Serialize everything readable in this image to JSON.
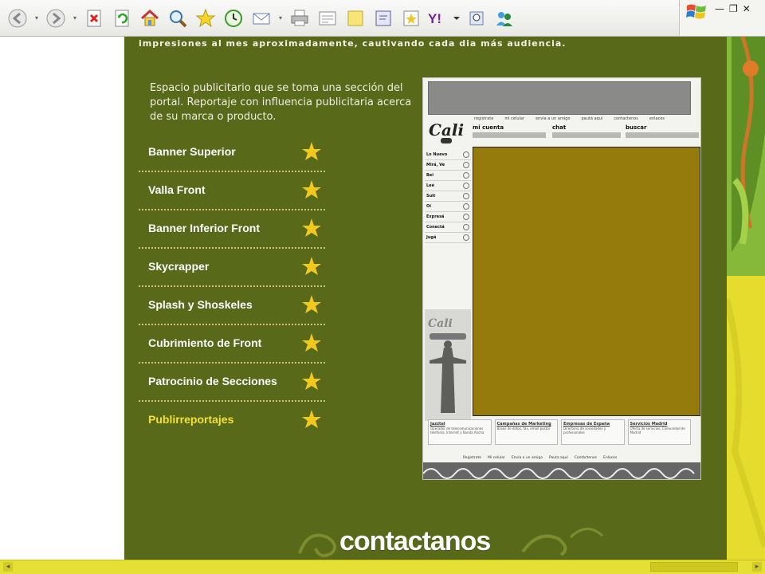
{
  "top_text": "impresiones al mes aproximadamente, cautivando cada dia más audiencia.",
  "description": "Espacio publicitario que se toma una sección del portal. Reportaje con influencia publicitaria acerca de su marca o producto.",
  "menu": [
    {
      "label": "Banner Superior",
      "active": false
    },
    {
      "label": "Valla Front",
      "active": false
    },
    {
      "label": "Banner Inferior Front",
      "active": false
    },
    {
      "label": "Skycrapper",
      "active": false
    },
    {
      "label": "Splash y Shoskeles",
      "active": false
    },
    {
      "label": "Cubrimiento de Front",
      "active": false
    },
    {
      "label": "Patrocinio de Secciones",
      "active": false
    },
    {
      "label": "Publirreportajes",
      "active": true
    }
  ],
  "preview": {
    "links": [
      "registrate",
      "mi celular",
      "envia a un amigo",
      "pautá aqui",
      "contactenos",
      "enlaces"
    ],
    "heads": [
      "mi cuenta",
      "chat",
      "buscar"
    ],
    "sidebar": [
      "Lo Nuevo",
      "Mirá, Ve",
      "Bei",
      "Leé",
      "Suit",
      "Oí",
      "Expresá",
      "Conectá",
      "Jugá"
    ],
    "footer_boxes": [
      {
        "title": "Jazztel",
        "text": "Operador de telecomunicaciones telefonía, Internet y Banda Ancha"
      },
      {
        "title": "Campañas de Marketing",
        "text": "Bases de datos, fax, email postal"
      },
      {
        "title": "Empresas de España",
        "text": "Directorio de sociedades y profesionales"
      },
      {
        "title": "Servicios Madrid",
        "text": "Oferta de servicios, Comunidad de Madrid"
      }
    ],
    "bottom_links": [
      "Regístrate",
      "Mi celular",
      "Envía a un amigo",
      "Pauta aquí",
      "Contáctenos",
      "Enlaces"
    ]
  },
  "contact_label": "contactanos",
  "colors": {
    "panel": "#58691a",
    "accent_yellow": "#f2e22b",
    "right_deco": "#e5dc2e",
    "preview_main": "#947b0c"
  }
}
